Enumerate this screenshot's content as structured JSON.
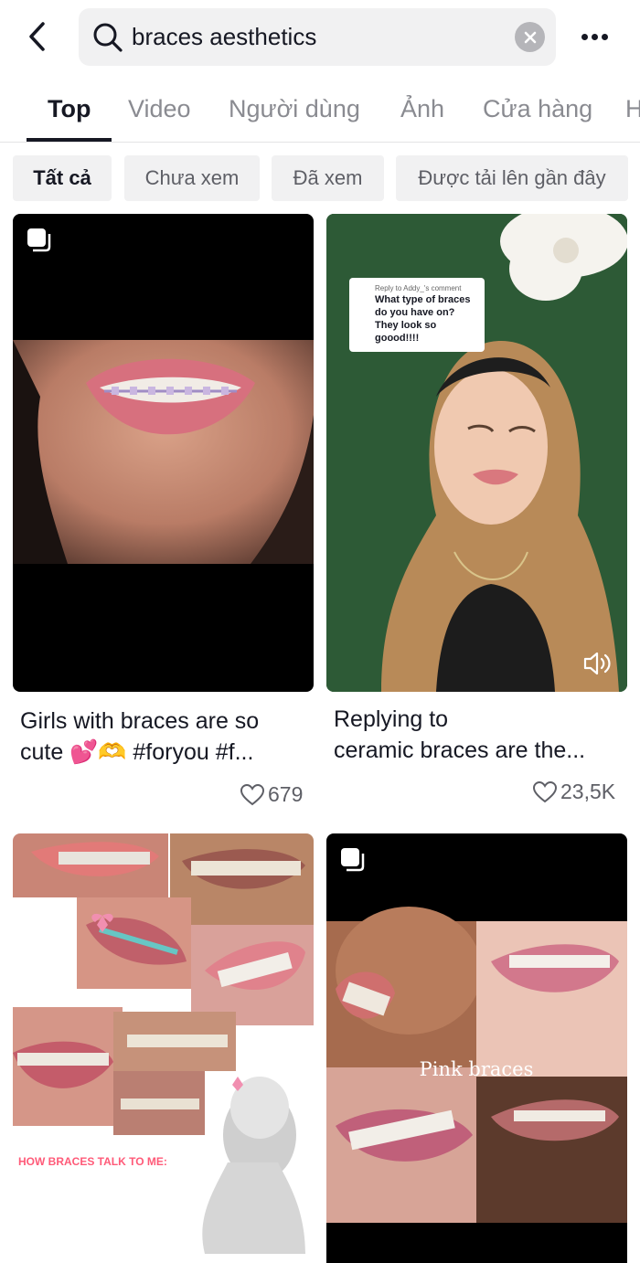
{
  "search": {
    "query": "braces aesthetics"
  },
  "icons": {
    "back": "chevron-left-icon",
    "search": "search-icon",
    "clear": "close-circle-icon",
    "more": "more-horizontal-icon",
    "multi_image": "image-stack-icon",
    "like": "heart-outline-icon",
    "volume": "volume-icon"
  },
  "tabs": [
    {
      "label": "Top",
      "active": true
    },
    {
      "label": "Video",
      "active": false
    },
    {
      "label": "Người dùng",
      "active": false
    },
    {
      "label": "Ảnh",
      "active": false
    },
    {
      "label": "Cửa hàng",
      "active": false
    },
    {
      "label": "H",
      "active": false
    }
  ],
  "filters": [
    {
      "label": "Tất cả",
      "active": true
    },
    {
      "label": "Chưa xem",
      "active": false
    },
    {
      "label": "Đã xem",
      "active": false
    },
    {
      "label": "Được tải lên gần đây",
      "active": false
    }
  ],
  "results": [
    {
      "caption_line1": "Girls with braces are so",
      "caption_line2": "cute 💕🫶  #foryou #f...",
      "likes": "679"
    },
    {
      "caption_line1": "Replying to",
      "caption_line2": "ceramic braces are the...",
      "likes": "23,5K",
      "overlay_reply_small": "Reply to Addy_'s comment",
      "overlay_reply_main": "What type of braces do you have on? They look so goood!!!!"
    },
    {
      "overlay_text": "HOW BRACES TALK TO ME:"
    },
    {
      "overlay_text": "Pink braces"
    }
  ],
  "colors": {
    "text_primary": "#161823",
    "text_secondary": "#8a8b91",
    "chip_bg": "#f1f1f2",
    "divider": "#e3e3e4",
    "accent_pink": "#ff5a78"
  }
}
